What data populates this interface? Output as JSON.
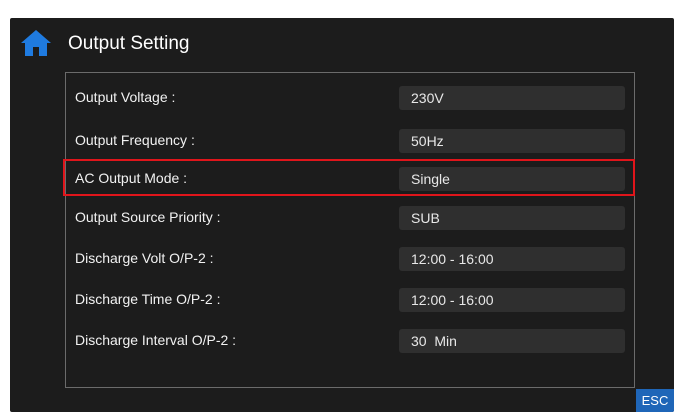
{
  "header": {
    "title": "Output Setting",
    "home_icon": "home-icon"
  },
  "settings": [
    {
      "label": "Output Voltage :",
      "value": "230V"
    },
    {
      "label": "Output Frequency :",
      "value": "50Hz"
    },
    {
      "label": "AC Output Mode :",
      "value": "Single",
      "highlighted": true
    },
    {
      "label": "Output Source Priority :",
      "value": "SUB"
    },
    {
      "label": "Discharge Volt O/P-2 :",
      "value": "12:00 - 16:00"
    },
    {
      "label": "Discharge Time O/P-2 :",
      "value": "12:00 - 16:00"
    },
    {
      "label": "Discharge Interval O/P-2 :",
      "value": "30  Min"
    }
  ],
  "footer": {
    "esc_label": "ESC"
  },
  "colors": {
    "background": "#1c1c1c",
    "field": "#2f2f2f",
    "highlight_border": "#e0151b",
    "accent": "#1f66b8"
  }
}
